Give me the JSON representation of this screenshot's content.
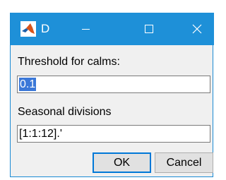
{
  "window": {
    "title": "D",
    "accent_color": "#1e90d8",
    "icon": "matlab-logo-icon"
  },
  "titlebar_controls": {
    "minimize_icon": "minimize-icon",
    "maximize_icon": "maximize-icon",
    "close_icon": "close-icon"
  },
  "fields": {
    "calms": {
      "label": "Threshold for calms:",
      "value": "0.1"
    },
    "seasonal": {
      "label": "Seasonal divisions",
      "value": "[1:1:12].'"
    }
  },
  "buttons": {
    "ok_label": "OK",
    "cancel_label": "Cancel"
  }
}
